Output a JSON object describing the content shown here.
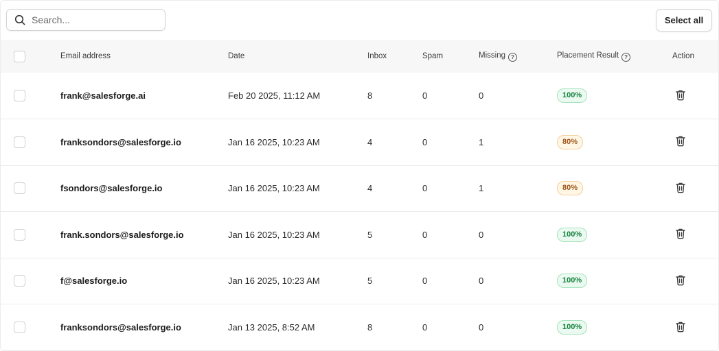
{
  "search": {
    "placeholder": "Search..."
  },
  "toolbar": {
    "select_all_label": "Select all"
  },
  "table": {
    "headers": {
      "email": "Email address",
      "date": "Date",
      "inbox": "Inbox",
      "spam": "Spam",
      "missing": "Missing",
      "placement_result": "Placement Result",
      "action": "Action"
    },
    "rows": [
      {
        "email": "frank@salesforge.ai",
        "date": "Feb 20 2025, 11:12 AM",
        "inbox": "8",
        "spam": "0",
        "missing": "0",
        "result": "100%",
        "status": "good"
      },
      {
        "email": "franksondors@salesforge.io",
        "date": "Jan 16 2025, 10:23 AM",
        "inbox": "4",
        "spam": "0",
        "missing": "1",
        "result": "80%",
        "status": "warn"
      },
      {
        "email": "fsondors@salesforge.io",
        "date": "Jan 16 2025, 10:23 AM",
        "inbox": "4",
        "spam": "0",
        "missing": "1",
        "result": "80%",
        "status": "warn"
      },
      {
        "email": "frank.sondors@salesforge.io",
        "date": "Jan 16 2025, 10:23 AM",
        "inbox": "5",
        "spam": "0",
        "missing": "0",
        "result": "100%",
        "status": "good"
      },
      {
        "email": "f@salesforge.io",
        "date": "Jan 16 2025, 10:23 AM",
        "inbox": "5",
        "spam": "0",
        "missing": "0",
        "result": "100%",
        "status": "good"
      },
      {
        "email": "franksondors@salesforge.io",
        "date": "Jan 13 2025, 8:52 AM",
        "inbox": "8",
        "spam": "0",
        "missing": "0",
        "result": "100%",
        "status": "good"
      }
    ]
  },
  "icons": {
    "search": "search-icon",
    "help": "help-circle-icon",
    "delete": "trash-icon",
    "checkbox": "checkbox-icon"
  },
  "colors": {
    "good_text": "#17803f",
    "good_bg": "#eafaf0",
    "warn_text": "#a0561a",
    "warn_bg": "#fff6e6"
  }
}
